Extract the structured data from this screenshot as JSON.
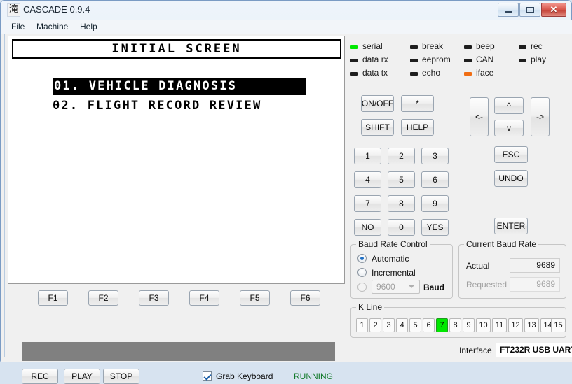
{
  "window": {
    "title": "CASCADE 0.9.4",
    "icon_glyph": "滝",
    "icon_name": "app-icon",
    "buttons": {
      "minimize": "minimize-icon",
      "maximize": "maximize-icon",
      "close": "✕"
    }
  },
  "menu": {
    "items": [
      {
        "label": "File"
      },
      {
        "label": "Machine"
      },
      {
        "label": "Help"
      }
    ]
  },
  "lcd": {
    "header": "INITIAL SCREEN",
    "lines": [
      {
        "text": "01. VEHICLE DIAGNOSIS",
        "selected": true
      },
      {
        "text": "02. FLIGHT RECORD REVIEW",
        "selected": false
      }
    ]
  },
  "function_keys": [
    {
      "label": "F1"
    },
    {
      "label": "F2"
    },
    {
      "label": "F3"
    },
    {
      "label": "F4"
    },
    {
      "label": "F5"
    },
    {
      "label": "F6"
    }
  ],
  "progress": {
    "value": 100,
    "color": "#808080"
  },
  "transport": [
    {
      "label": "REC"
    },
    {
      "label": "PLAY"
    },
    {
      "label": "STOP"
    }
  ],
  "grab_keyboard": {
    "label": "Grab Keyboard",
    "checked": true
  },
  "status": {
    "text": "RUNNING",
    "color": "#137a2b"
  },
  "leds": [
    {
      "label": "serial",
      "state": "green"
    },
    {
      "label": "data rx",
      "state": "off"
    },
    {
      "label": "data tx",
      "state": "off"
    },
    {
      "label": "break",
      "state": "off"
    },
    {
      "label": "eeprom",
      "state": "off"
    },
    {
      "label": "echo",
      "state": "off"
    },
    {
      "label": "beep",
      "state": "off"
    },
    {
      "label": "CAN",
      "state": "off"
    },
    {
      "label": "iface",
      "state": "orange"
    },
    {
      "label": "rec",
      "state": "off"
    },
    {
      "label": "play",
      "state": "off"
    }
  ],
  "keypad": {
    "control": [
      {
        "label": "ON/OFF"
      },
      {
        "label": "*"
      },
      {
        "label": "SHIFT"
      },
      {
        "label": "HELP"
      }
    ],
    "numbers": [
      {
        "label": "1"
      },
      {
        "label": "2"
      },
      {
        "label": "3"
      },
      {
        "label": "4"
      },
      {
        "label": "5"
      },
      {
        "label": "6"
      },
      {
        "label": "7"
      },
      {
        "label": "8"
      },
      {
        "label": "9"
      },
      {
        "label": "NO"
      },
      {
        "label": "0"
      },
      {
        "label": "YES"
      }
    ],
    "navigation": [
      {
        "label": "<-",
        "name": "left"
      },
      {
        "label": "^",
        "name": "up"
      },
      {
        "label": "v",
        "name": "down"
      },
      {
        "label": "->",
        "name": "right"
      }
    ],
    "actions": [
      {
        "label": "ESC"
      },
      {
        "label": "UNDO"
      },
      {
        "label": "ENTER"
      }
    ]
  },
  "baud_control": {
    "title": "Baud Rate Control",
    "options": [
      {
        "label": "Automatic",
        "selected": true,
        "disabled": false
      },
      {
        "label": "Incremental",
        "selected": false,
        "disabled": false
      },
      {
        "label": "",
        "selected": false,
        "disabled": true
      }
    ],
    "combo_value": "9600",
    "combo_suffix": "Baud"
  },
  "current_baud": {
    "title": "Current Baud Rate",
    "actual_label": "Actual",
    "actual_value": "9689",
    "requested_label": "Requested",
    "requested_value": "9689"
  },
  "kline": {
    "title": "K Line",
    "buttons": [
      "1",
      "2",
      "3",
      "4",
      "5",
      "6",
      "7",
      "8",
      "9",
      "10",
      "11",
      "12",
      "13",
      "14",
      "15"
    ],
    "active": "7",
    "active_color": "#00e800"
  },
  "interface": {
    "label": "Interface",
    "value": "FT232R USB UART"
  }
}
